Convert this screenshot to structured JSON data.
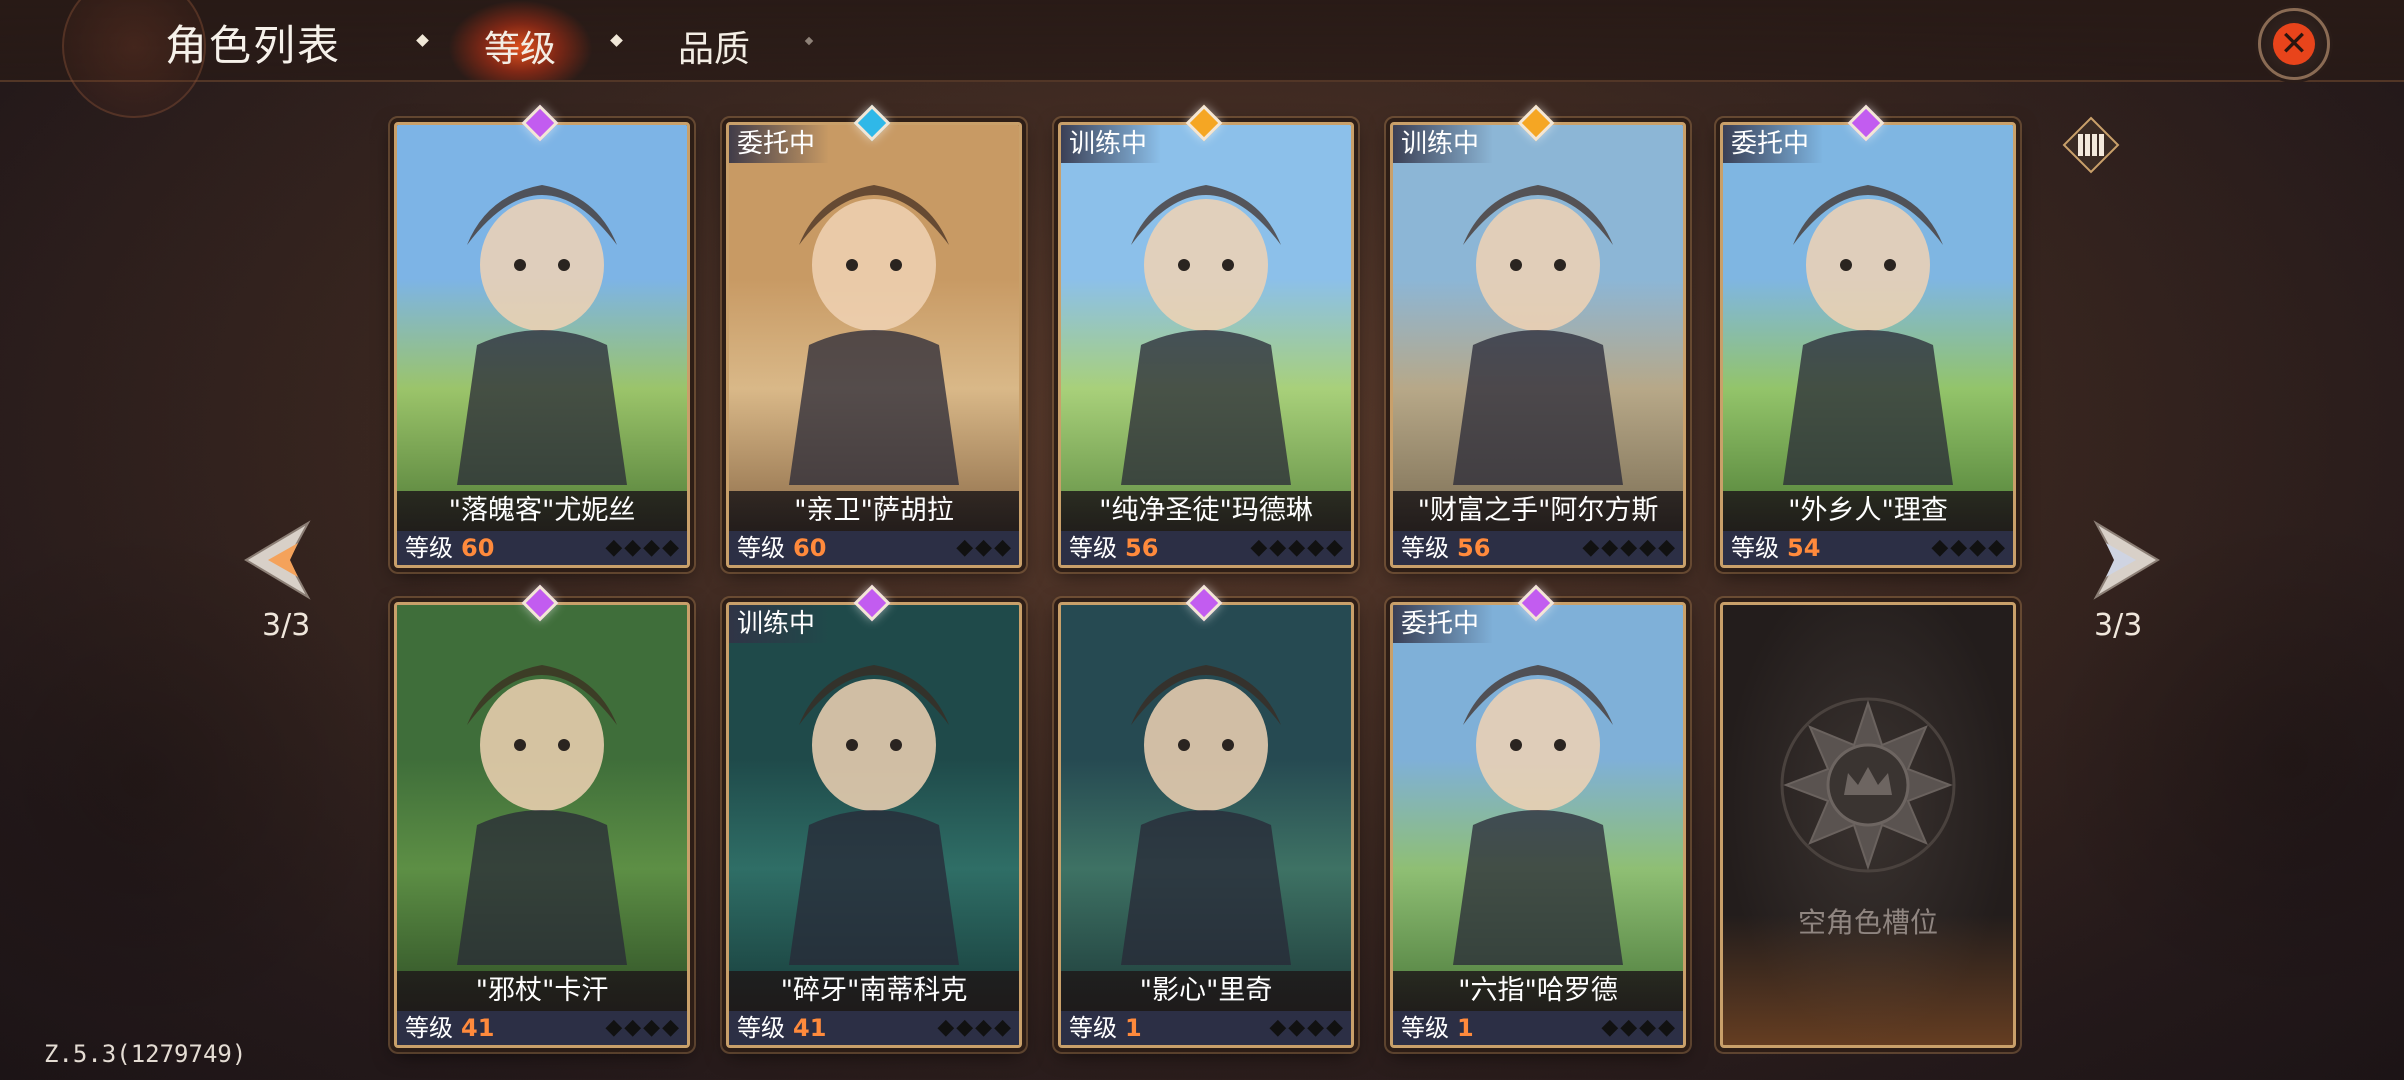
{
  "header": {
    "title": "角色列表",
    "tabs": [
      {
        "label": "等级",
        "active": true
      },
      {
        "label": "品质",
        "active": false
      }
    ]
  },
  "nav": {
    "left_page": "3/3",
    "right_page": "3/3"
  },
  "level_label": "等级",
  "cards": [
    {
      "name": "\"落魄客\"尤妮丝",
      "level": "60",
      "status": "",
      "gem_color": "#c25cf0",
      "stars": 4
    },
    {
      "name": "\"亲卫\"萨胡拉",
      "level": "60",
      "status": "委托中",
      "gem_color": "#2fb8e8",
      "stars": 3
    },
    {
      "name": "\"纯净圣徒\"玛德琳",
      "level": "56",
      "status": "训练中",
      "gem_color": "#f5a623",
      "stars": 5
    },
    {
      "name": "\"财富之手\"阿尔方斯",
      "level": "56",
      "status": "训练中",
      "gem_color": "#f5a623",
      "stars": 5
    },
    {
      "name": "\"外乡人\"理查",
      "level": "54",
      "status": "委托中",
      "gem_color": "#c25cf0",
      "stars": 4
    },
    {
      "name": "\"邪杖\"卡汗",
      "level": "41",
      "status": "",
      "gem_color": "#c25cf0",
      "stars": 4
    },
    {
      "name": "\"碎牙\"南蒂科克",
      "level": "41",
      "status": "训练中",
      "gem_color": "#c25cf0",
      "stars": 4
    },
    {
      "name": "\"影心\"里奇",
      "level": "1",
      "status": "",
      "gem_color": "#c25cf0",
      "stars": 4
    },
    {
      "name": "\"六指\"哈罗德",
      "level": "1",
      "status": "委托中",
      "gem_color": "#c25cf0",
      "stars": 4
    }
  ],
  "empty_slot": {
    "label": "空角色槽位"
  },
  "version": "Z.5.3(1279749)"
}
